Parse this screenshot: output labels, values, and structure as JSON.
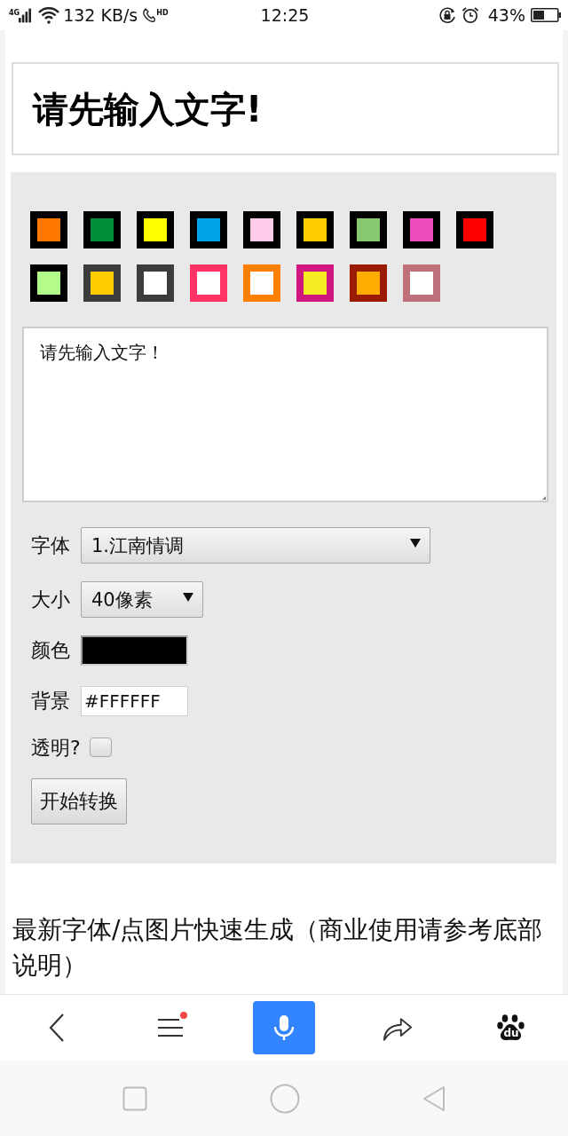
{
  "status_bar": {
    "network": "4G",
    "speed": "132 KB/s",
    "call_badge": "HD",
    "time": "12:25",
    "battery": "43%"
  },
  "preview": {
    "text": "请先输入文字!"
  },
  "palette": {
    "swatches": [
      {
        "color": "#ff7700",
        "frame": {
          "color": "#000000"
        }
      },
      {
        "color": "#008f39",
        "frame": {
          "color": "#000000"
        }
      },
      {
        "color": "#ffff00",
        "frame": {
          "color": "#000000"
        }
      },
      {
        "color": "#00a2e8",
        "frame": {
          "color": "#000000"
        }
      },
      {
        "color": "#ffccea",
        "frame": {
          "color": "#000000"
        }
      },
      {
        "color": "#ffcc00",
        "frame": {
          "color": "#000000"
        }
      },
      {
        "color": "#88c86e",
        "frame": {
          "color": "#000000"
        }
      },
      {
        "color": "#ee4cbc",
        "frame": {
          "color": "#000000"
        }
      },
      {
        "color": "#ff0000",
        "frame": {
          "color": "#000000"
        }
      },
      {
        "color": "#b3fc8a",
        "frame": {
          "color": "#000000"
        }
      },
      {
        "color": "#ffcc00",
        "frame": {
          "color": "#3c3c3c"
        }
      },
      {
        "color": "#ffffff",
        "frame": {
          "color": "#3c3c3c"
        }
      },
      {
        "color": "#ffffff",
        "frame": {
          "color": "#ff3366"
        }
      },
      {
        "color": "#ffffff",
        "frame": {
          "color": "#ff7f00"
        }
      },
      {
        "color": "#f5ec21",
        "frame": {
          "color": "#d0177f"
        }
      },
      {
        "color": "#ffad00",
        "frame": {
          "color": "#9b1b00"
        }
      },
      {
        "color": "#ffffff",
        "frame": {
          "color": "#c0707a"
        }
      }
    ]
  },
  "text_input": {
    "value": "请先输入文字！"
  },
  "form": {
    "font": {
      "label": "字体",
      "value": "1.江南情调"
    },
    "size": {
      "label": "大小",
      "value": "40像素"
    },
    "color": {
      "label": "颜色",
      "color": "#000000"
    },
    "background": {
      "label": "背景",
      "value": "#FFFFFF"
    },
    "transparent": {
      "label": "透明?",
      "checked": false
    },
    "submit": {
      "label": "开始转换"
    }
  },
  "section_title": "最新字体/点图片快速生成（商业使用请参考底部说明）",
  "bottom_bar": {
    "menu_badge": true,
    "logo_text": "du"
  }
}
